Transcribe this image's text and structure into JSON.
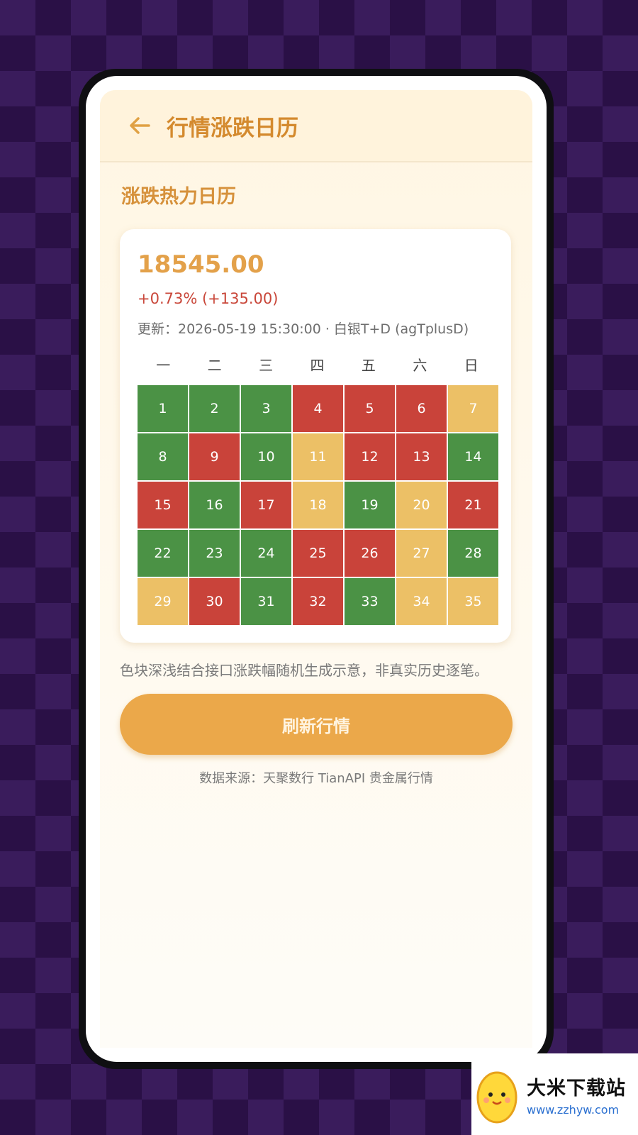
{
  "header": {
    "back_icon": "arrow-left-icon",
    "title": "行情涨跌日历"
  },
  "section_title": "涨跌热力日历",
  "quote": {
    "price": "18545.00",
    "change": "+0.73%  (+135.00)",
    "updated": "更新：2026-05-19 15:30:00  ·  白银T+D (agTplusD)"
  },
  "weekdays": [
    "一",
    "二",
    "三",
    "四",
    "五",
    "六",
    "日"
  ],
  "colors": {
    "up": "#c9433a",
    "down": "#4b9245",
    "flat": "#ecc066"
  },
  "calendar": [
    {
      "day": "1",
      "status": "down"
    },
    {
      "day": "2",
      "status": "down"
    },
    {
      "day": "3",
      "status": "down"
    },
    {
      "day": "4",
      "status": "up"
    },
    {
      "day": "5",
      "status": "up"
    },
    {
      "day": "6",
      "status": "up"
    },
    {
      "day": "7",
      "status": "flat"
    },
    {
      "day": "8",
      "status": "down"
    },
    {
      "day": "9",
      "status": "up"
    },
    {
      "day": "10",
      "status": "down"
    },
    {
      "day": "11",
      "status": "flat"
    },
    {
      "day": "12",
      "status": "up"
    },
    {
      "day": "13",
      "status": "up"
    },
    {
      "day": "14",
      "status": "down"
    },
    {
      "day": "15",
      "status": "up"
    },
    {
      "day": "16",
      "status": "down"
    },
    {
      "day": "17",
      "status": "up"
    },
    {
      "day": "18",
      "status": "flat"
    },
    {
      "day": "19",
      "status": "down"
    },
    {
      "day": "20",
      "status": "flat"
    },
    {
      "day": "21",
      "status": "up"
    },
    {
      "day": "22",
      "status": "down"
    },
    {
      "day": "23",
      "status": "down"
    },
    {
      "day": "24",
      "status": "down"
    },
    {
      "day": "25",
      "status": "up"
    },
    {
      "day": "26",
      "status": "up"
    },
    {
      "day": "27",
      "status": "flat"
    },
    {
      "day": "28",
      "status": "down"
    },
    {
      "day": "29",
      "status": "flat"
    },
    {
      "day": "30",
      "status": "up"
    },
    {
      "day": "31",
      "status": "down"
    },
    {
      "day": "32",
      "status": "up"
    },
    {
      "day": "33",
      "status": "down"
    },
    {
      "day": "34",
      "status": "flat"
    },
    {
      "day": "35",
      "status": "flat"
    }
  ],
  "note": "色块深浅结合接口涨跌幅随机生成示意，非真实历史逐笔。",
  "refresh_button": "刷新行情",
  "source": "数据来源：天聚数行 TianAPI 贵金属行情",
  "watermark": {
    "name": "大米下载站",
    "url": "www.zzhyw.com",
    "logo_icon": "mango-mascot-icon"
  }
}
